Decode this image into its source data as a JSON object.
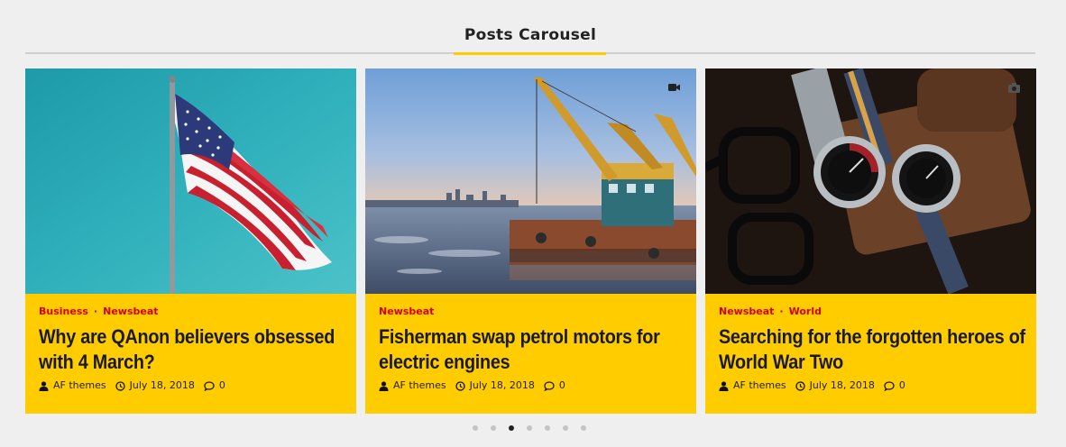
{
  "section": {
    "title": "Posts Carousel"
  },
  "colors": {
    "accent": "#ffcc00",
    "category": "#d40000",
    "background": "#efefef"
  },
  "posts": [
    {
      "categories": [
        "Business",
        "Newsbeat"
      ],
      "title": "Why are QAnon believers obsessed with 4 March?",
      "author": "AF themes",
      "date": "July 18, 2018",
      "comments": "0",
      "media_icon": "",
      "image": "american-flag-on-pole"
    },
    {
      "categories": [
        "Newsbeat"
      ],
      "title": "Fisherman swap petrol motors for electric engines",
      "author": "AF themes",
      "date": "July 18, 2018",
      "comments": "0",
      "media_icon": "video-camera-icon",
      "image": "crane-barge-on-river"
    },
    {
      "categories": [
        "Newsbeat",
        "World"
      ],
      "title": "Searching for the forgotten heroes of World War Two",
      "author": "AF themes",
      "date": "July 18, 2018",
      "comments": "0",
      "media_icon": "camera-icon",
      "image": "watches-and-glasses"
    }
  ],
  "carousel": {
    "dot_count": 7,
    "active_index": 2
  }
}
